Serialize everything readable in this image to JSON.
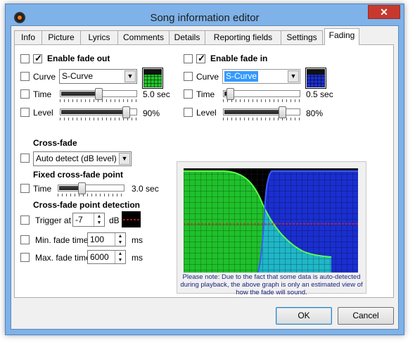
{
  "window": {
    "title": "Song information editor",
    "close_glyph": "✕"
  },
  "tabs": [
    {
      "label": "Info",
      "active": false
    },
    {
      "label": "Picture",
      "active": false
    },
    {
      "label": "Lyrics",
      "active": false
    },
    {
      "label": "Comments",
      "active": false
    },
    {
      "label": "Details",
      "active": false
    },
    {
      "label": "Reporting fields",
      "active": false
    },
    {
      "label": "Settings",
      "active": false
    },
    {
      "label": "Fading",
      "active": true
    }
  ],
  "fade_out": {
    "enable_label": "Enable fade out",
    "enable_checked": true,
    "curve_label": "Curve",
    "curve_value": "S-Curve",
    "time_label": "Time",
    "time_value": "5.0 sec",
    "time_fraction": 0.5,
    "level_label": "Level",
    "level_value": "90%",
    "level_fraction": 0.9,
    "swatch_color": "#22c42a"
  },
  "fade_in": {
    "enable_label": "Enable fade in",
    "enable_checked": true,
    "curve_label": "Curve",
    "curve_value": "S-Curve",
    "time_label": "Time",
    "time_value": "0.5 sec",
    "time_fraction": 0.05,
    "level_label": "Level",
    "level_value": "80%",
    "level_fraction": 0.8,
    "swatch_color": "#1a2fd0"
  },
  "crossfade": {
    "heading": "Cross-fade",
    "mode_value": "Auto detect (dB level)",
    "fixed_heading": "Fixed cross-fade point",
    "time_label": "Time",
    "time_value": "3.0 sec",
    "time_fraction": 0.35,
    "detection_heading": "Cross-fade point detection",
    "trigger_label": "Trigger at",
    "trigger_value": "-7",
    "trigger_unit": "dB",
    "min_fade_label": "Min. fade time",
    "min_fade_value": "100",
    "min_fade_unit": "ms",
    "max_fade_label": "Max. fade time",
    "max_fade_value": "6000",
    "max_fade_unit": "ms"
  },
  "graph": {
    "note": "Please note: Due to the fact that some data is auto-detected during playback, the above graph is only an estimated view of how the fade will sound.",
    "colors": {
      "background": "#000000",
      "fade_out": "#1fc12b",
      "fade_in": "#1a2fd0",
      "overlap": "#1fb7c8",
      "trigger_line": "#e02020"
    }
  },
  "buttons": {
    "ok": "OK",
    "cancel": "Cancel"
  }
}
